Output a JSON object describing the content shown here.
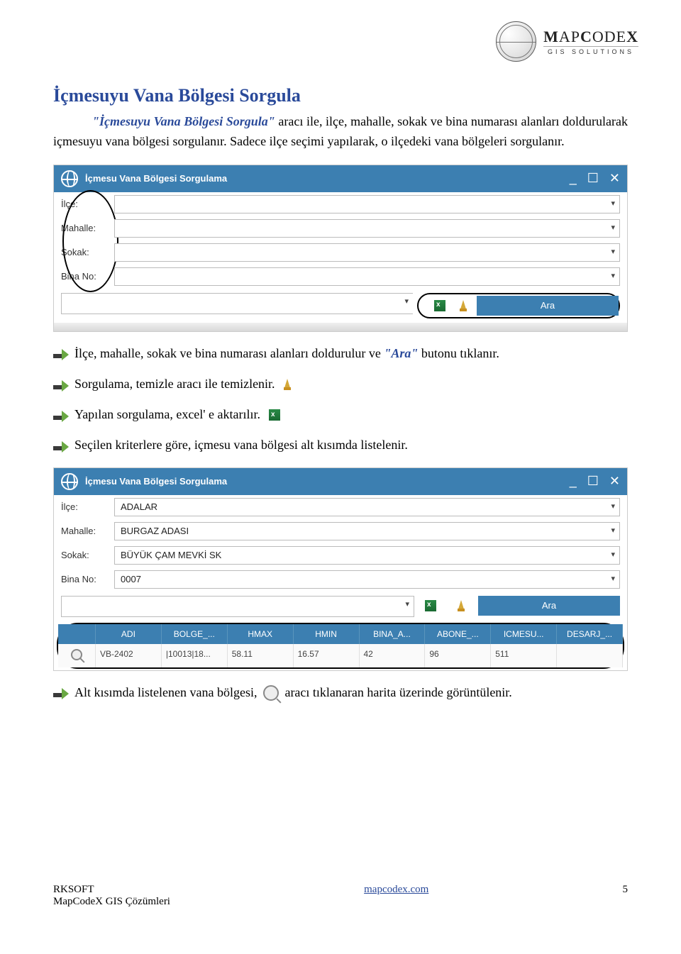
{
  "brand": {
    "tagline": "GIS SOLUTIONS"
  },
  "heading": "İçmesuyu Vana Bölgesi Sorgula",
  "intro": {
    "quoted": "\"İçmesuyu Vana Bölgesi Sorgula\"",
    "rest": " aracı ile, ilçe, mahalle, sokak ve bina numarası alanları doldurularak içmesuyu vana bölgesi sorgulanır. Sadece ilçe seçimi yapılarak, o ilçedeki vana bölgeleri sorgulanır."
  },
  "win": {
    "title": "İçmesu Vana Bölgesi Sorgulama"
  },
  "form": {
    "labels": {
      "ilce": "İlçe:",
      "mahalle": "Mahalle:",
      "sokak": "Sokak:",
      "binano": "Bina No:"
    },
    "values": {
      "ilce": "ADALAR",
      "mahalle": "BURGAZ ADASI",
      "sokak": "BÜYÜK ÇAM MEVKİ SK",
      "binano": "0007"
    },
    "search_label": "Ara"
  },
  "bullets": {
    "0": {
      "pre": "İlçe, mahalle, sokak ve bina numarası alanları doldurulur ve ",
      "quoted": "\"Ara\"",
      "post": " butonu tıklanır."
    },
    "1": {
      "text": "Sorgulama, temizle aracı ile temizlenir."
    },
    "2": {
      "text": "Yapılan sorgulama, excel' e aktarılır."
    },
    "3": {
      "text": "Seçilen kriterlere göre, içmesu vana bölgesi alt kısımda listelenir."
    },
    "4": {
      "pre": "Alt kısımda listelenen vana bölgesi, ",
      "post": " aracı tıklanaran harita üzerinde görüntülenir."
    }
  },
  "table": {
    "cols": [
      "ADI",
      "BOLGE_...",
      "HMAX",
      "HMIN",
      "BINA_A...",
      "ABONE_...",
      "ICMESU...",
      "DESARJ_..."
    ],
    "row": [
      "VB-2402",
      "|10013|18...",
      "58.11",
      "16.57",
      "42",
      "96",
      "511",
      ""
    ]
  },
  "footer": {
    "left1": "RKSOFT",
    "left2": "MapCodeX GIS Çözümleri",
    "center": "mapcodex.com",
    "page": "5"
  }
}
